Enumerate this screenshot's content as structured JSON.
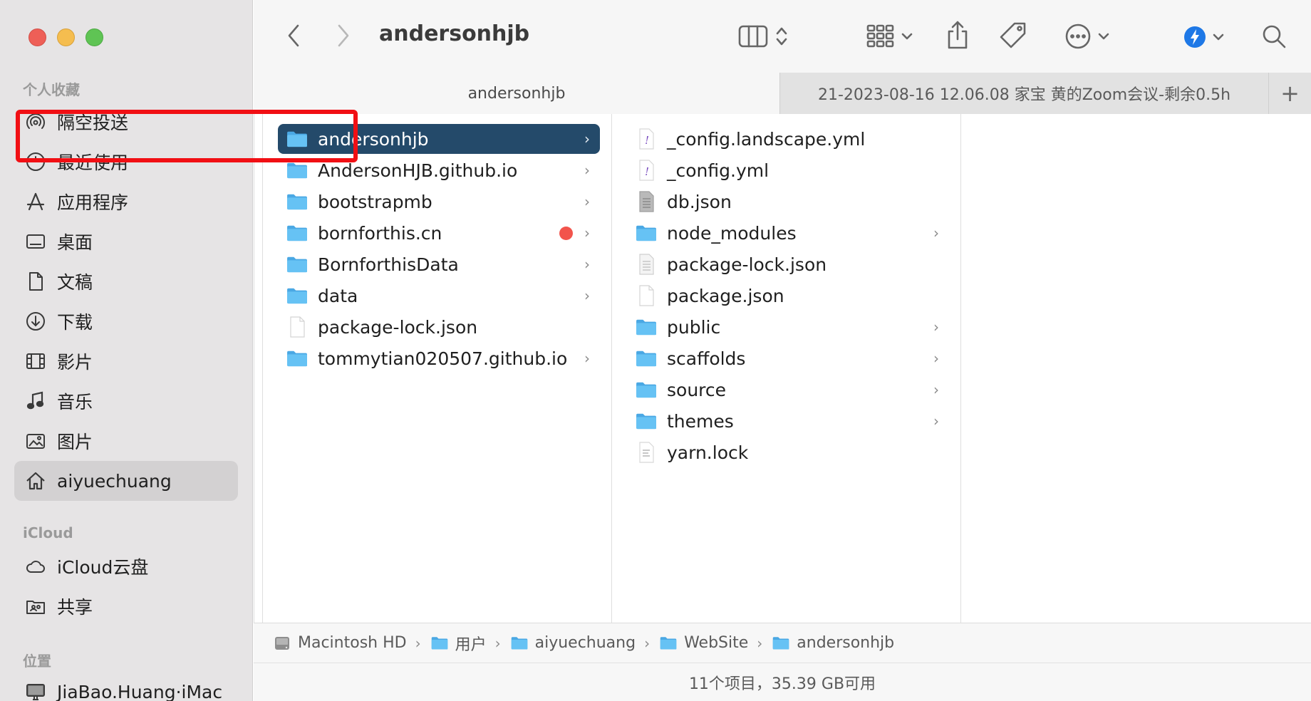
{
  "window": {
    "title": "andersonhjb"
  },
  "sidebar": {
    "sections": {
      "favorites": "个人收藏",
      "icloud": "iCloud",
      "locations": "位置"
    },
    "favorites": [
      {
        "label": "隔空投送",
        "icon": "airdrop-icon"
      },
      {
        "label": "最近使用",
        "icon": "clock-icon"
      },
      {
        "label": "应用程序",
        "icon": "applications-icon"
      },
      {
        "label": "桌面",
        "icon": "desktop-icon"
      },
      {
        "label": "文稿",
        "icon": "document-icon"
      },
      {
        "label": "下载",
        "icon": "download-icon"
      },
      {
        "label": "影片",
        "icon": "film-icon"
      },
      {
        "label": "音乐",
        "icon": "music-icon"
      },
      {
        "label": "图片",
        "icon": "photo-icon"
      },
      {
        "label": "aiyuechuang",
        "icon": "home-icon",
        "selected": true
      }
    ],
    "icloud": [
      {
        "label": "iCloud云盘",
        "icon": "cloud-icon"
      },
      {
        "label": "共享",
        "icon": "shared-folder-icon"
      }
    ],
    "locations": [
      {
        "label": "JiaBao.Huang·iMac",
        "icon": "computer-icon"
      }
    ]
  },
  "tabs": [
    {
      "label": "andersonhjb",
      "active": true
    },
    {
      "label": "21-2023-08-16 12.06.08 家宝 黄的Zoom会议-剩余0.5h",
      "active": false
    }
  ],
  "tab_add_label": "+",
  "column1": [
    {
      "name": "andersonhjb",
      "type": "folder",
      "chevron": true,
      "selected": true
    },
    {
      "name": "AndersonHJB.github.io",
      "type": "folder",
      "chevron": true
    },
    {
      "name": "bootstrapmb",
      "type": "folder",
      "chevron": true
    },
    {
      "name": "bornforthis.cn",
      "type": "folder",
      "chevron": true,
      "tag": "#f2544c"
    },
    {
      "name": "BornforthisData",
      "type": "folder",
      "chevron": true
    },
    {
      "name": "data",
      "type": "folder",
      "chevron": true
    },
    {
      "name": "package-lock.json",
      "type": "file"
    },
    {
      "name": "tommytian020507.github.io",
      "type": "folder",
      "chevron": true
    }
  ],
  "column2": [
    {
      "name": "_config.landscape.yml",
      "type": "yml"
    },
    {
      "name": "_config.yml",
      "type": "yml"
    },
    {
      "name": "db.json",
      "type": "json-gray"
    },
    {
      "name": "node_modules",
      "type": "folder",
      "chevron": true
    },
    {
      "name": "package-lock.json",
      "type": "file-lines"
    },
    {
      "name": "package.json",
      "type": "file"
    },
    {
      "name": "public",
      "type": "folder",
      "chevron": true
    },
    {
      "name": "scaffolds",
      "type": "folder",
      "chevron": true
    },
    {
      "name": "source",
      "type": "folder",
      "chevron": true
    },
    {
      "name": "themes",
      "type": "folder",
      "chevron": true
    },
    {
      "name": "yarn.lock",
      "type": "text"
    }
  ],
  "chevron_glyph": "›",
  "pathbar": [
    {
      "label": "Macintosh HD",
      "icon": "hard-drive-icon"
    },
    {
      "label": "用户",
      "icon": "folder-icon"
    },
    {
      "label": "aiyuechuang",
      "icon": "home-folder-icon"
    },
    {
      "label": "WebSite",
      "icon": "folder-icon"
    },
    {
      "label": "andersonhjb",
      "icon": "folder-icon"
    }
  ],
  "status": "11个项目，35.39 GB可用",
  "colors": {
    "selection": "#244a6a",
    "folder": "#5ab8f0",
    "highlight": "#f10f14"
  }
}
